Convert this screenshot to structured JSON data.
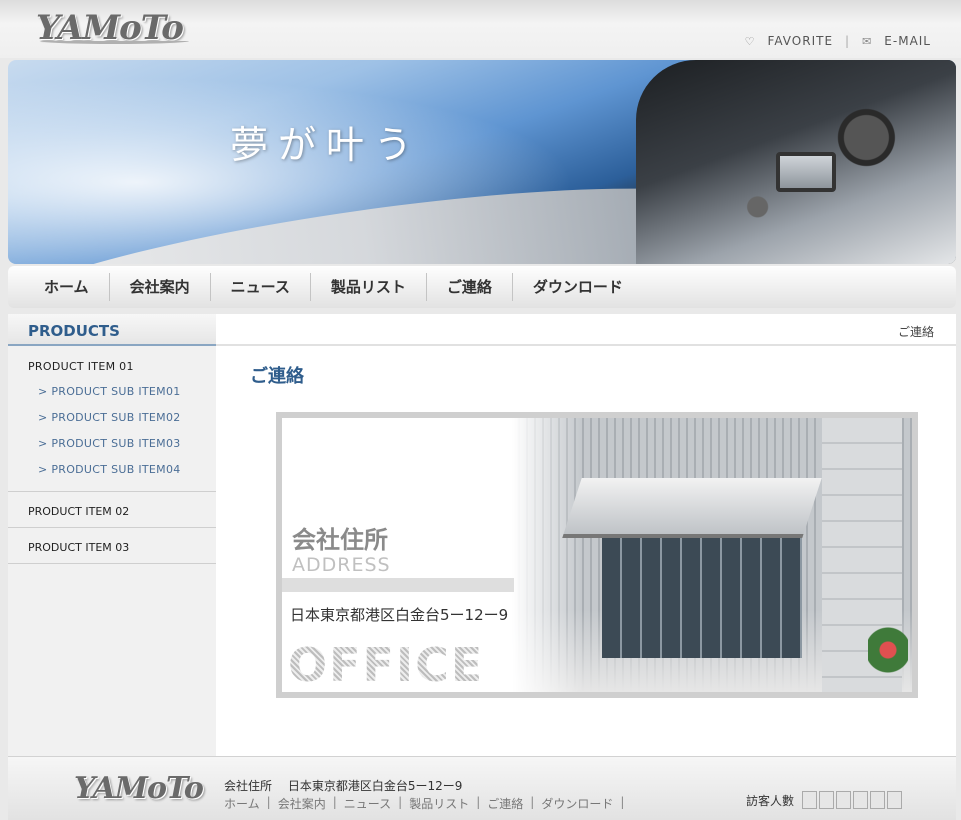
{
  "header": {
    "logo": "YAMoTo",
    "links": [
      {
        "icon": "heart-icon",
        "label": "FAVORITE"
      },
      {
        "icon": "mail-icon",
        "label": "E-MAIL"
      }
    ]
  },
  "banner": {
    "slogan": "夢が叶う"
  },
  "nav": {
    "items": [
      "ホーム",
      "会社案内",
      "ニュース",
      "製品リスト",
      "ご連絡",
      "ダウンロード"
    ]
  },
  "sidebar": {
    "title": "PRODUCTS",
    "groups": [
      {
        "label": "PRODUCT ITEM 01",
        "subs": [
          "> PRODUCT SUB ITEM01",
          "> PRODUCT SUB ITEM02",
          "> PRODUCT SUB ITEM03",
          "> PRODUCT SUB ITEM04"
        ]
      }
    ],
    "items": [
      "PRODUCT ITEM 02",
      "PRODUCT ITEM 03"
    ]
  },
  "content": {
    "breadcrumb": "ご連絡",
    "title": "ご連絡",
    "card": {
      "label_jp": "会社住所",
      "label_en": "ADDRESS",
      "address": "日本東京都港区白金台5ー12ー9",
      "office": "OFFICE"
    }
  },
  "footer": {
    "logo": "YAMoTo",
    "address_label": "会社住所",
    "address": "日本東京都港区白金台5ー12ー9",
    "links": [
      "ホーム",
      "会社案内",
      "ニュース",
      "製品リスト",
      "ご連絡",
      "ダウンロード"
    ],
    "visitor_label": "訪客人數",
    "visitor_count": "",
    "counter_boxes": 6
  },
  "colors": {
    "accent": "#2f5d8c",
    "sidebar_bg": "#f1f1f1",
    "page_bg": "#e9e9e9"
  }
}
